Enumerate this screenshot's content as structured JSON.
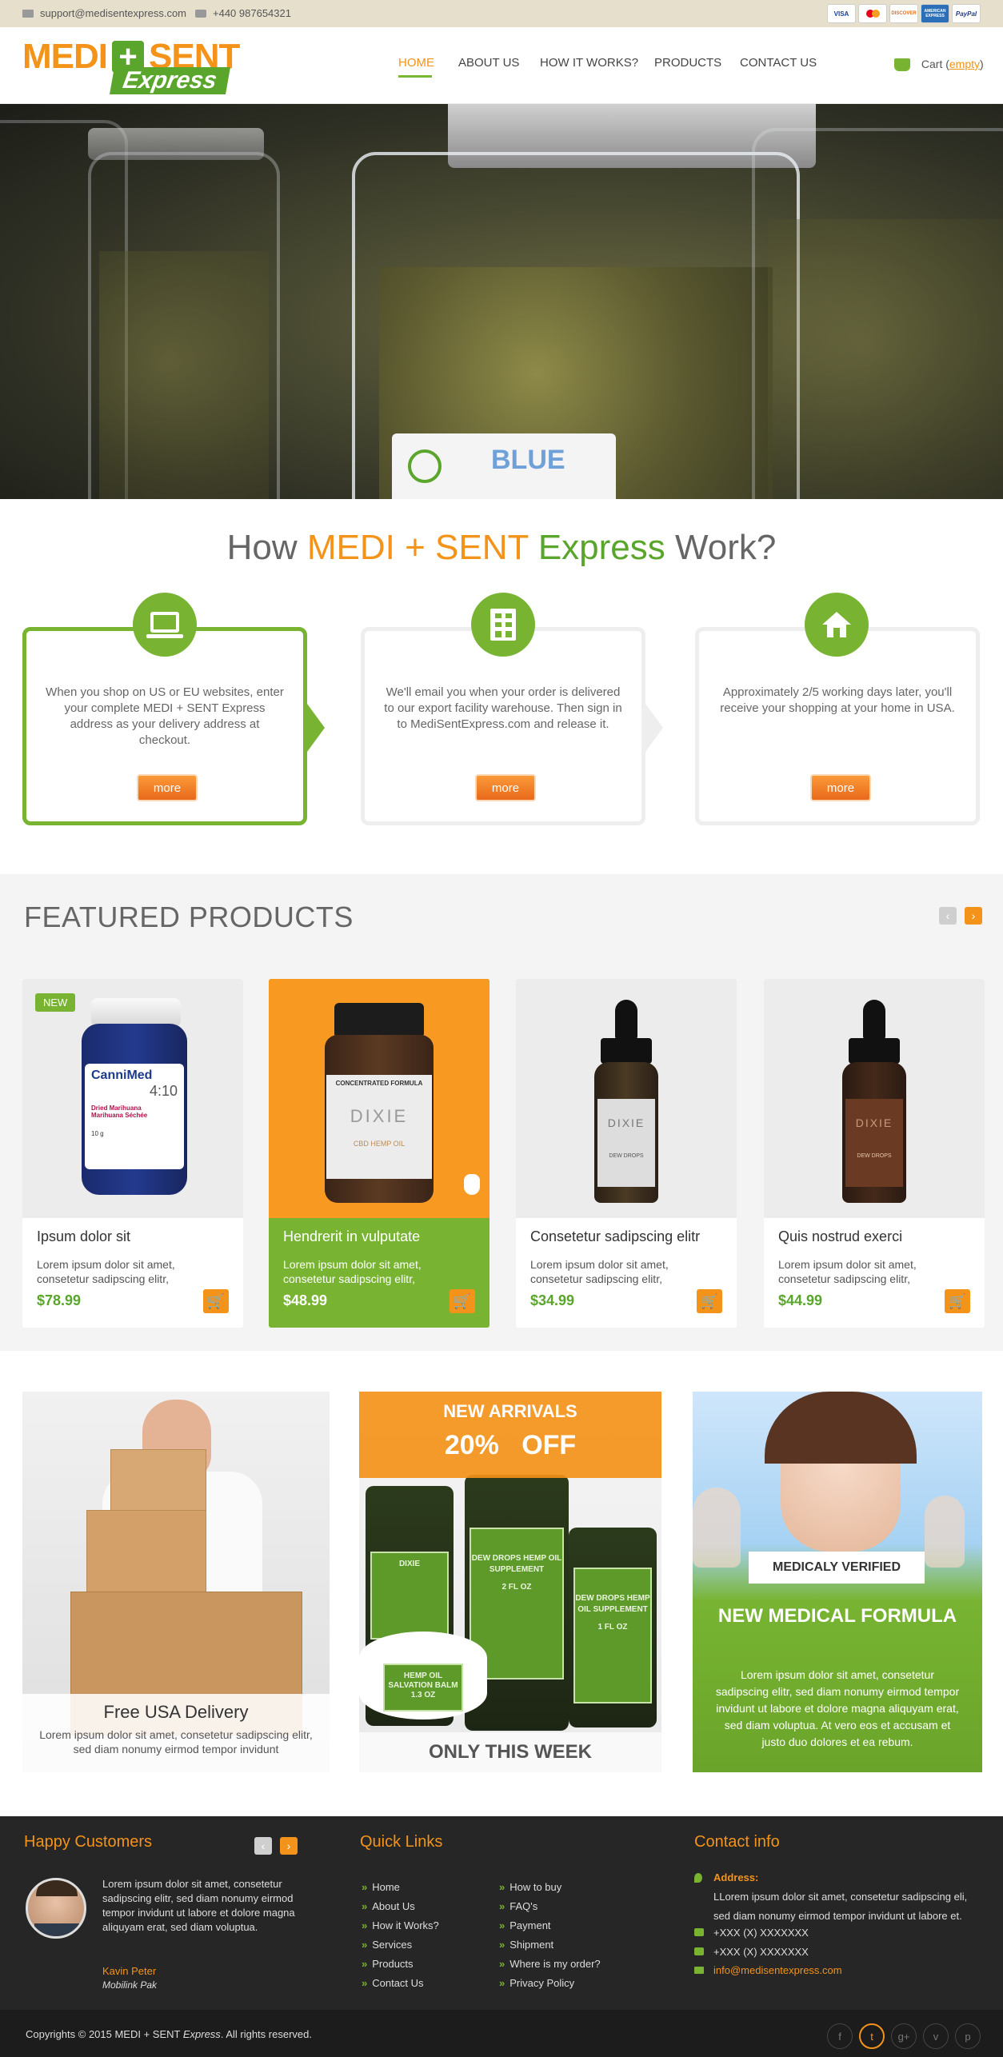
{
  "topbar": {
    "email": "support@medisentexpress.com",
    "phone": "+440 987654321",
    "payments": [
      "VISA",
      "MasterCard",
      "DISCOVER",
      "AMERICAN EXPRESS",
      "PayPal"
    ]
  },
  "brand": {
    "part1": "MEDI",
    "cross": "+",
    "part2": "SENT",
    "express": "Express"
  },
  "nav": {
    "items": [
      "HOME",
      "ABOUT US",
      "HOW IT WORKS?",
      "PRODUCTS",
      "CONTACT US"
    ],
    "cart_label": "Cart (",
    "cart_state": "empty",
    "cart_close": ")"
  },
  "hero": {
    "jar_label": "BLUE"
  },
  "how": {
    "title_pre": "How ",
    "title_brand1": "MEDI + SENT ",
    "title_brand2": "Express",
    "title_post": " Work?",
    "steps": [
      {
        "icon": "laptop-icon",
        "text": "When you shop on US or EU websites, enter your complete MEDI + SENT Express address as your delivery address at checkout.",
        "button": "more"
      },
      {
        "icon": "building-icon",
        "text": "We'll email you when your order is delivered to our export facility warehouse. Then sign in to MediSentExpress.com and release it.",
        "button": "more"
      },
      {
        "icon": "home-icon",
        "text": "Approximately 2/5 working days later, you'll receive your shopping at your home in USA.",
        "button": "more"
      }
    ]
  },
  "featured": {
    "title": "FEATURED PRODUCTS",
    "products": [
      {
        "badge": "NEW",
        "name": "Ipsum dolor sit",
        "desc": "Lorem ipsum dolor sit amet, consetetur sadipscing elitr,",
        "price": "$78.99",
        "label_line1": "CanniMed",
        "label_line2": "4:10",
        "label_line3": "Dried Marihuana",
        "label_line4": "Marihuana Séchée",
        "label_line5": "10 g"
      },
      {
        "badge": "",
        "name": "Hendrerit in vulputate",
        "desc": "Lorem ipsum dolor sit amet, consetetur sadipscing elitr,",
        "price": "$48.99",
        "label_line1": "CONCENTRATED FORMULA",
        "label_line2": "DIXIE",
        "label_line3": "CBD HEMP OIL"
      },
      {
        "badge": "",
        "name": "Consetetur sadipscing elitr",
        "desc": "Lorem ipsum dolor sit amet, consetetur sadipscing elitr,",
        "price": "$34.99",
        "label_line1": "DIXIE",
        "label_line2": "DEW DROPS"
      },
      {
        "badge": "",
        "name": "Quis nostrud exerci",
        "desc": "Lorem ipsum dolor sit amet, consetetur sadipscing elitr,",
        "price": "$44.99",
        "label_line1": "DIXIE",
        "label_line2": "DEW DROPS"
      }
    ]
  },
  "promos": {
    "delivery_title": "Free USA Delivery",
    "delivery_text": "Lorem ipsum dolor sit amet, consetetur sadipscing elitr, sed diam nonumy eirmod tempor invidunt",
    "arrivals_line1": "NEW ARRIVALS",
    "arrivals_line2": "20%   OFF",
    "arrivals_footer": "ONLY THIS WEEK",
    "bottle_labels": [
      "DIXIE",
      "DEW DROPS HEMP OIL SUPPLEMENT",
      "2 FL OZ",
      "DEW DROPS HEMP OIL SUPPLEMENT",
      "1 FL OZ",
      "HEMP OIL SALVATION BALM",
      "1.3 OZ"
    ],
    "verified_badge": "MEDICALY VERIFIED",
    "verified_title": "NEW MEDICAL FORMULA",
    "verified_text": "Lorem ipsum dolor sit amet, consetetur sadipscing elitr, sed diam nonumy eirmod tempor invidunt ut labore et dolore magna aliquyam erat, sed diam voluptua. At vero eos et accusam et justo duo dolores et ea rebum."
  },
  "footer": {
    "happy_title": "Happy Customers",
    "testimonial": "Lorem ipsum dolor sit amet, consetetur sadipscing elitr, sed diam nonumy eirmod tempor invidunt ut labore et dolore magna aliquyam erat, sed diam voluptua.",
    "customer_name": "Kavin Peter",
    "customer_company": "Mobilink Pak",
    "quick_title": "Quick Links",
    "links_col1": [
      "Home",
      "About Us",
      "How it Works?",
      "Services",
      "Products",
      "Contact Us"
    ],
    "links_col2": [
      "How to buy",
      "FAQ's",
      "Payment",
      "Shipment",
      "Where is my order?",
      "Privacy Policy"
    ],
    "contact_title": "Contact info",
    "address_label": "Address:",
    "address_text": "LLorem ipsum dolor sit amet, consetetur sadipscing eli, sed diam nonumy eirmod tempor invidunt ut labore et.",
    "phone1": "+XXX (X) XXXXXXX",
    "phone2": "+XXX (X) XXXXXXX",
    "email": "info@medisentexpress.com",
    "copyright_pre": "Copyrights © 2015 MEDI + SENT ",
    "copyright_em": "Express",
    "copyright_post": ". All rights reserved.",
    "social": [
      "f",
      "t",
      "g+",
      "v",
      "p"
    ]
  },
  "colors": {
    "orange": "#f39319",
    "green": "#78b432",
    "dark": "#262626"
  }
}
